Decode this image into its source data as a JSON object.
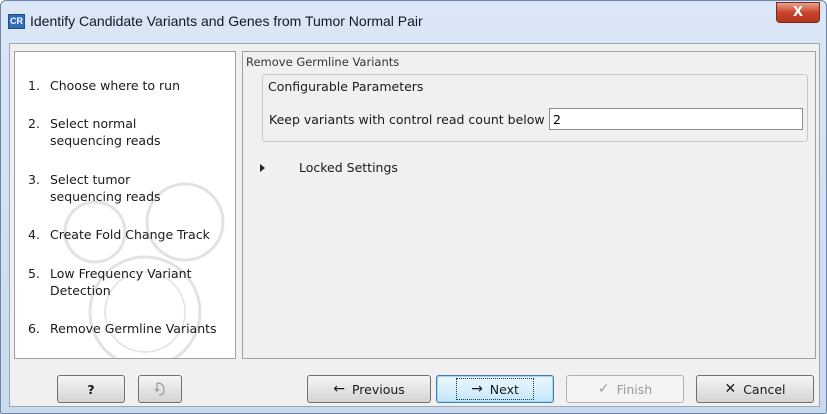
{
  "window": {
    "app_icon_text": "CR",
    "title": "Identify Candidate Variants and Genes from Tumor Normal Pair",
    "close_glyph": "X"
  },
  "steps": [
    {
      "num": "1.",
      "label": "Choose where to run"
    },
    {
      "num": "2.",
      "label": "Select normal sequencing reads"
    },
    {
      "num": "3.",
      "label": "Select tumor sequencing reads"
    },
    {
      "num": "4.",
      "label": "Create Fold Change Track"
    },
    {
      "num": "5.",
      "label": "Low Frequency Variant Detection"
    },
    {
      "num": "6.",
      "label": "Remove Germline Variants"
    }
  ],
  "panel": {
    "title": "Remove Germline Variants",
    "group_title": "Configurable Parameters",
    "param_label": "Keep variants with control read count below",
    "param_value": "2",
    "locked_label": "Locked Settings"
  },
  "buttons": {
    "help": {
      "label": "?"
    },
    "reset": {
      "icon": "reset-icon"
    },
    "previous": {
      "label": "Previous",
      "icon": "arrow-left-icon"
    },
    "next": {
      "label": "Next",
      "icon": "arrow-right-icon"
    },
    "finish": {
      "label": "Finish",
      "icon": "checkmark-icon"
    },
    "cancel": {
      "label": "Cancel",
      "icon": "x-icon"
    }
  }
}
